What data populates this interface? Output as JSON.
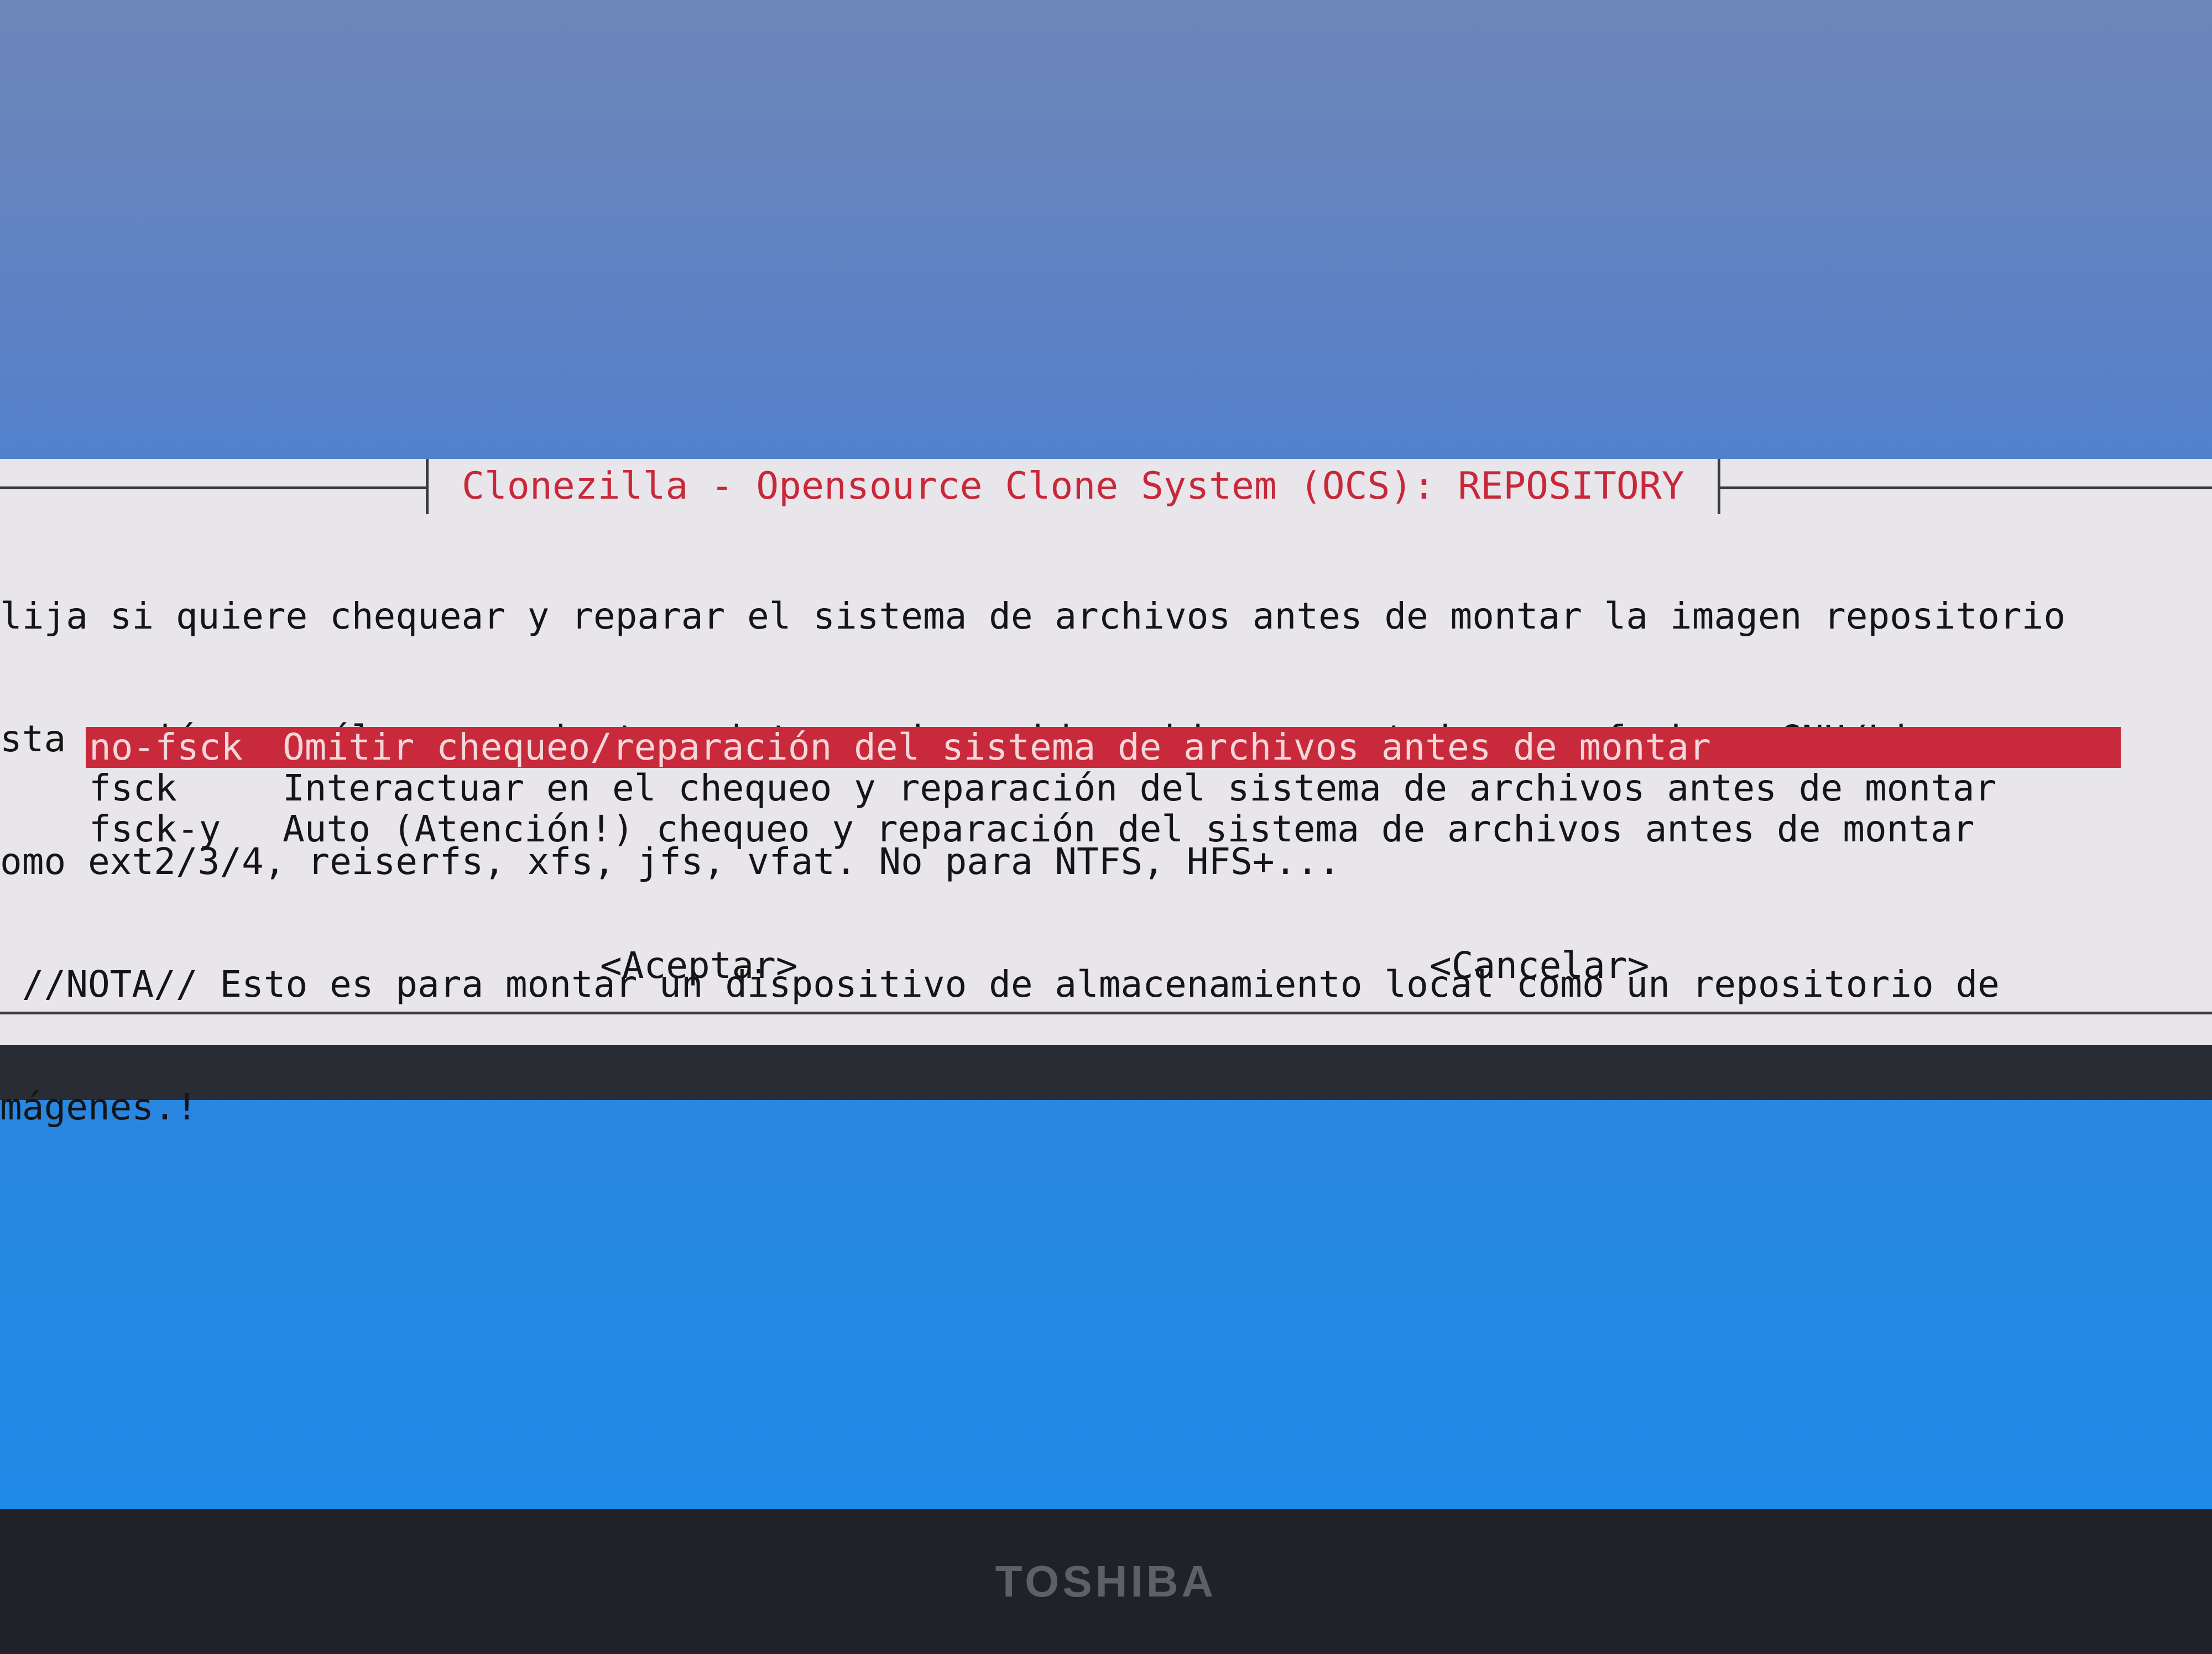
{
  "dialog": {
    "title": "Clonezilla - Opensource Clone System (OCS): REPOSITORY",
    "description": [
      "lija si quiere chequear y reparar el sistema de archivos antes de montar la imagen repositorio",
      "sta opción es sólo para ciertos sistemas de archivos bien soportados por fsck en GNU/Linux,",
      "omo ext2/3/4, reiserfs, xfs, jfs, vfat. No para NTFS, HFS+...",
      " //NOTA// Esto es para montar un dispositivo de almacenamiento local como un repositorio de",
      "mágenes.!"
    ],
    "menu": [
      {
        "tag": "no-fsck",
        "label": "Omitir chequeo/reparación del sistema de archivos antes de montar",
        "selected": true
      },
      {
        "tag": "fsck",
        "label": "Interactuar en el chequeo y reparación del sistema de archivos antes de montar",
        "selected": false
      },
      {
        "tag": "fsck-y",
        "label": "Auto (Atención!) chequeo y reparación del sistema de archivos antes de montar",
        "selected": false
      }
    ],
    "buttons": {
      "ok": "<Aceptar>",
      "cancel": "<Cancelar>"
    }
  },
  "bezel": {
    "brand": "TOSHIBA"
  },
  "colors": {
    "title_text": "#c8283a",
    "selection_bg": "#c92a3b",
    "dialog_bg": "#e8e6ea",
    "screen_bg": "#2a86e0"
  }
}
